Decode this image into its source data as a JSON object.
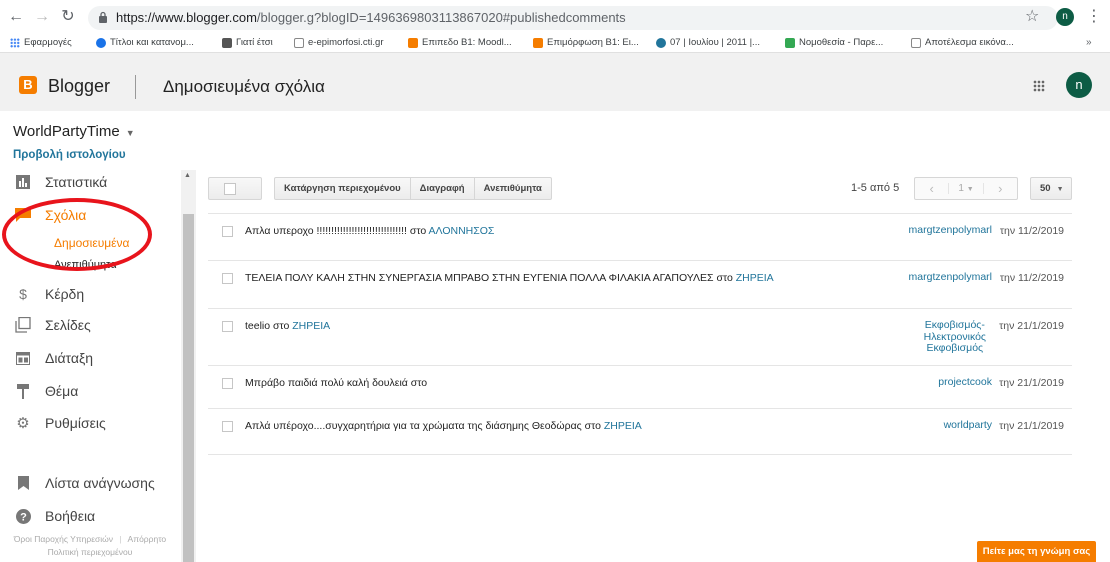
{
  "browser": {
    "url_main": "https://www.blogger.com",
    "url_rest": "/blogger.g?blogID=1496369803113867020#publishedcomments",
    "avatar_letter": "n",
    "bookmarks": [
      {
        "label": "Εφαρμογές",
        "color": "#4285f4"
      },
      {
        "label": "Τίτλοι και κατανομ...",
        "color": "#1a73e8"
      },
      {
        "label": "Γιατί έτσι",
        "color": "#555555"
      },
      {
        "label": "e-epimorfosi.cti.gr",
        "color": "#888888"
      },
      {
        "label": "Επιπεδο Β1: Moodl...",
        "color": "#f57d00"
      },
      {
        "label": "Επιμόρφωση Β1: Ει...",
        "color": "#f57d00"
      },
      {
        "label": "07 | Ιουλίου | 2011 |...",
        "color": "#21759b"
      },
      {
        "label": "Νομοθεσία - Παρε...",
        "color": "#34a853"
      },
      {
        "label": "Αποτέλεσμα εικόνα...",
        "color": "#888888"
      }
    ],
    "more": "»"
  },
  "header": {
    "logo_letter": "B",
    "app_name": "Blogger",
    "page_title": "Δημοσιευμένα σχόλια",
    "avatar_letter": "n"
  },
  "sidebar": {
    "blog_name": "WorldPartyTime",
    "view_blog": "Προβολή ιστολογίου",
    "items": [
      {
        "label": "Στατιστικά",
        "icon": "bar-chart-icon"
      },
      {
        "label": "Σχόλια",
        "icon": "comment-icon"
      },
      {
        "label": "Κέρδη",
        "icon": "dollar-icon"
      },
      {
        "label": "Σελίδες",
        "icon": "pages-icon"
      },
      {
        "label": "Διάταξη",
        "icon": "layout-icon"
      },
      {
        "label": "Θέμα",
        "icon": "paint-roller-icon"
      },
      {
        "label": "Ρυθμίσεις",
        "icon": "gear-icon"
      },
      {
        "label": "Λίστα ανάγνωσης",
        "icon": "bookmark-icon"
      },
      {
        "label": "Βοήθεια",
        "icon": "help-icon"
      }
    ],
    "sub_items": {
      "published": "Δημοσιευμένα",
      "spam": "Ανεπιθύμητα"
    },
    "footer": {
      "terms": "Όροι Παροχής Υπηρεσιών",
      "privacy": "Απόρρητο",
      "content_policy": "Πολιτική περιεχομένου"
    }
  },
  "toolbar": {
    "remove_content": "Κατάργηση περιεχομένου",
    "delete": "Διαγραφή",
    "spam": "Ανεπιθύμητα"
  },
  "pagination": {
    "range_text": "1-5 από 5",
    "page": "1",
    "per_page": "50"
  },
  "comments": [
    {
      "text": "Απλα υπεροχο !!!!!!!!!!!!!!!!!!!!!!!!!!!!!!! στο",
      "post": "ΑΛΟΝΝΗΣΟΣ",
      "author": "margtzenpolymarl",
      "date": "την 11/2/2019"
    },
    {
      "text": "ΤΕΛΕΙΑ ΠΟΛΥ ΚΑΛΗ ΣΤΗΝ ΣΥΝΕΡΓΑΣΙΑ ΜΠΡΑΒΟ ΣΤΗΝ ΕΥΓΕΝΙΑ ΠΟΛΛΑ ΦΙΛΑΚΙΑ ΑΓΑΠΟΥΛΕΣ στο",
      "post": "ΖΗΡΕΙΑ",
      "author": "margtzenpolymarl",
      "date": "την 11/2/2019"
    },
    {
      "text": "teelio στο",
      "post": "ΖΗΡΕΙΑ",
      "author_lines": [
        "Εκφοβισμός-",
        "Ηλεκτρονικός",
        "Εκφοβισμός"
      ],
      "date": "την 21/1/2019"
    },
    {
      "text": "Μπράβο παιδιά πολύ καλή δουλειά στο",
      "post": "",
      "author": "projectcook",
      "date": "την 21/1/2019"
    },
    {
      "text": "Απλά υπέροχο....συγχαρητήρια για τα χρώματα της διάσημης Θεοδώρας στο",
      "post": "ΖΗΡΕΙΑ",
      "author": "worldparty",
      "date": "την 21/1/2019"
    }
  ],
  "feedback_button": "Πείτε μας τη γνώμη σας",
  "colors": {
    "accent": "#f57d00",
    "link": "#21759b",
    "annotation_red": "#e8141c",
    "avatar_green": "#0d5c45"
  }
}
